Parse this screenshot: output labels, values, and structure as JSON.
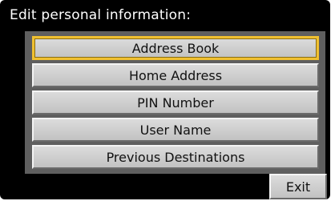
{
  "title": "Edit personal information:",
  "menu": {
    "items": [
      {
        "label": "Address Book",
        "selected": true
      },
      {
        "label": "Home Address",
        "selected": false
      },
      {
        "label": "PIN Number",
        "selected": false
      },
      {
        "label": "User Name",
        "selected": false
      },
      {
        "label": "Previous Destinations",
        "selected": false
      }
    ]
  },
  "exit_label": "Exit",
  "colors": {
    "background": "#000000",
    "panel": "#5f5f5f",
    "button_face": "#cfcfcf",
    "selection_border": "#f0c030",
    "title_text": "#ffffff"
  }
}
